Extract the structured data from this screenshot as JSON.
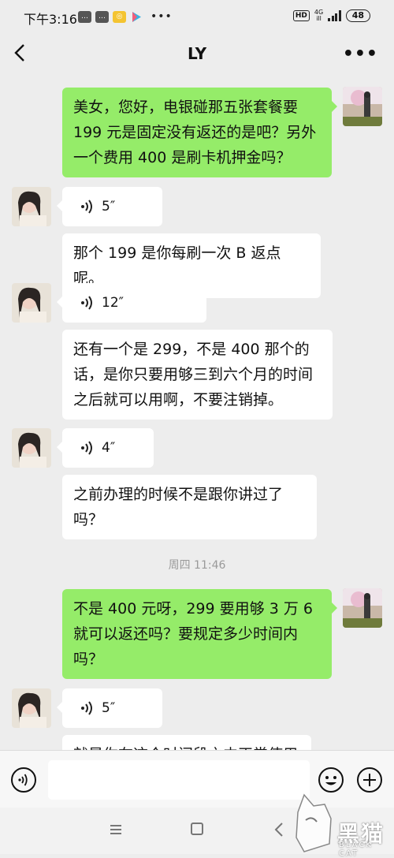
{
  "status_bar": {
    "time": "下午3:16",
    "network_top": "4G",
    "network_bottom": "ill",
    "hd": "HD",
    "battery": "48"
  },
  "header": {
    "title": "LY"
  },
  "messages": [
    {
      "sender": "me",
      "type": "text",
      "text": "美女，您好，电银碰那五张套餐要199 元是固定没有返还的是吧？另外一个费用 400 是刷卡机押金吗？"
    },
    {
      "sender": "other",
      "type": "voice",
      "duration": "5″"
    },
    {
      "sender": "other",
      "type": "text",
      "text": "那个 199 是你每刷一次 B 返点呢。"
    },
    {
      "sender": "other",
      "type": "voice",
      "duration": "12″"
    },
    {
      "sender": "other",
      "type": "text",
      "text": "还有一个是 299，不是 400 那个的话，是你只要用够三到六个月的时间之后就可以用啊，不要注销掉。"
    },
    {
      "sender": "other",
      "type": "voice",
      "duration": "4″"
    },
    {
      "sender": "other",
      "type": "text",
      "text": "之前办理的时候不是跟你讲过了吗？"
    },
    {
      "sender": "me",
      "type": "text",
      "text": "不是 400 元呀，299 要用够 3 万 6 就可以返还吗？要规定多少时间内吗？"
    },
    {
      "sender": "other",
      "type": "voice",
      "duration": "5″"
    },
    {
      "sender": "other",
      "type": "text",
      "text": "就是你在这个时间段之内正常使用"
    }
  ],
  "timestamp": "周四 11:46",
  "watermark": {
    "text": "黑猫",
    "sub": "BLACK CAT"
  },
  "colors": {
    "outgoing": "#95ec69",
    "incoming": "#ffffff",
    "background": "#ededed"
  }
}
